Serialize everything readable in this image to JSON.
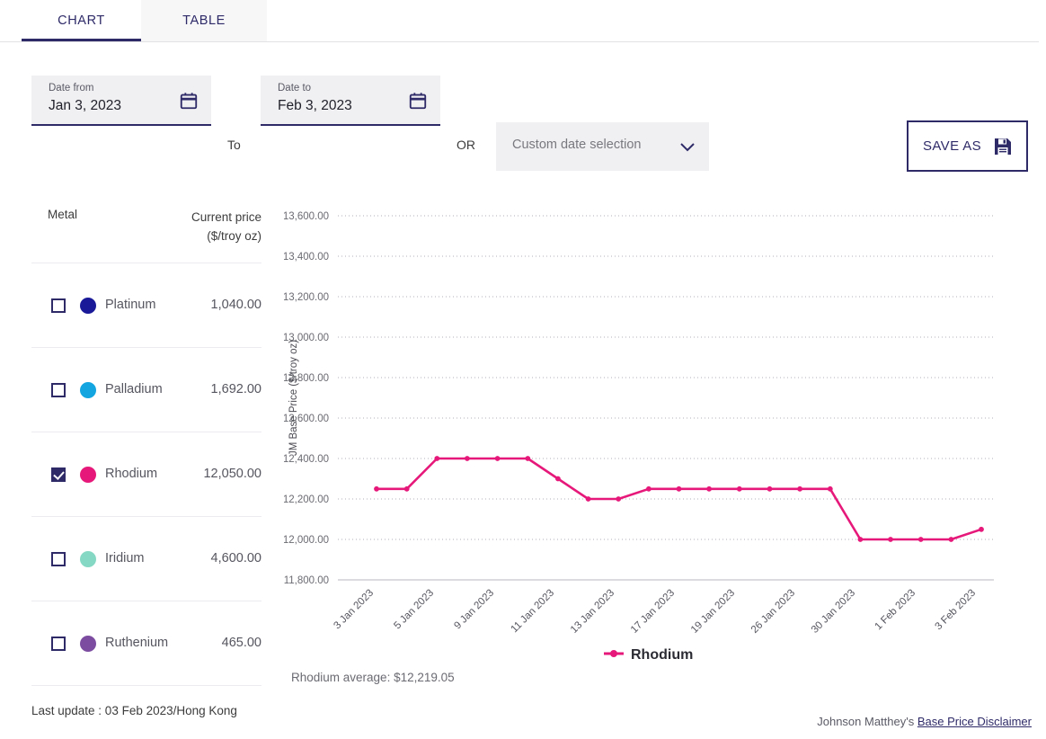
{
  "tabs": [
    {
      "label": "CHART",
      "active": true
    },
    {
      "label": "TABLE",
      "active": false
    }
  ],
  "filters": {
    "date_from": {
      "label": "Date from",
      "value": "Jan 3, 2023",
      "icon": "calendar-icon"
    },
    "to_label": "To",
    "date_to": {
      "label": "Date to",
      "value": "Feb 3, 2023",
      "icon": "calendar-icon"
    },
    "or_label": "OR",
    "custom_select": {
      "value": "Custom date selection",
      "icon": "chevron-down-icon"
    },
    "save_as": {
      "label": "SAVE AS",
      "icon": "floppy-disk-save-icon"
    }
  },
  "metals_table": {
    "header": {
      "metal": "Metal",
      "price_line1": "Current price",
      "price_line2": "($/troy oz)"
    },
    "rows": [
      {
        "name": "Platinum",
        "price": "1,040.00",
        "color": "#1a1a99",
        "checked": false
      },
      {
        "name": "Palladium",
        "price": "1,692.00",
        "color": "#12a5e0",
        "checked": false
      },
      {
        "name": "Rhodium",
        "price": "12,050.00",
        "color": "#e6197a",
        "checked": true
      },
      {
        "name": "Iridium",
        "price": "4,600.00",
        "color": "#85d8c4",
        "checked": false
      },
      {
        "name": "Ruthenium",
        "price": "465.00",
        "color": "#7b4ca0",
        "checked": false
      }
    ]
  },
  "last_update": "Last update : 03 Feb 2023/Hong Kong",
  "footer": {
    "prefix": "Johnson Matthey's ",
    "link": "Base Price Disclaimer"
  },
  "chart_average_text": "Rhodium average: $12,219.05",
  "chart_data": {
    "type": "line",
    "title": "",
    "xlabel": "",
    "ylabel": "JM Base Price ($/troy oz)",
    "ylim": [
      11800,
      13600
    ],
    "ytick_step": 200,
    "ytick_labels": [
      "13,600.00",
      "13,400.00",
      "13,200.00",
      "13,000.00",
      "12,800.00",
      "12,600.00",
      "12,400.00",
      "12,200.00",
      "12,000.00",
      "11,800.00"
    ],
    "ytick_values": [
      13600,
      13400,
      13200,
      13000,
      12800,
      12600,
      12400,
      12200,
      12000,
      11800
    ],
    "xtick_labels": [
      "3 Jan 2023",
      "5 Jan 2023",
      "9 Jan 2023",
      "11 Jan 2023",
      "13 Jan 2023",
      "17 Jan 2023",
      "19 Jan 2023",
      "26 Jan 2023",
      "30 Jan 2023",
      "1 Feb 2023",
      "3 Feb 2023"
    ],
    "grid": true,
    "legend_position": "bottom",
    "series": [
      {
        "name": "Rhodium",
        "color": "#e6197a",
        "values": [
          12250,
          12250,
          12400,
          12400,
          12400,
          12400,
          12300,
          12200,
          12200,
          12250,
          12250,
          12250,
          12250,
          12250,
          12250,
          12250,
          12000,
          12000,
          12000,
          12000,
          12050
        ]
      }
    ],
    "legend": [
      {
        "label": "Rhodium",
        "color": "#e6197a",
        "marker": "line-with-dot"
      }
    ]
  }
}
